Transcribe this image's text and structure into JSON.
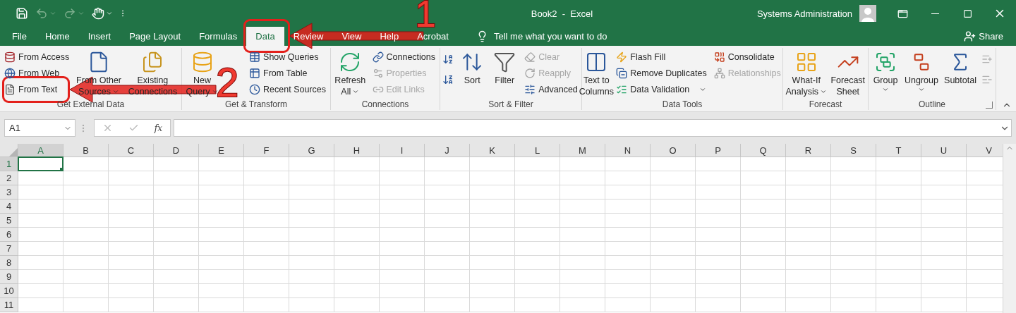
{
  "title_bar": {
    "quick_access": [
      {
        "disabled": false
      },
      {
        "disabled": true
      },
      {
        "disabled": true
      },
      {
        "disabled": false
      }
    ],
    "title": "Book2  -  Excel",
    "user": "Systems Administration"
  },
  "tabs": [
    {
      "label": "File",
      "selected": false
    },
    {
      "label": "Home",
      "selected": false
    },
    {
      "label": "Insert",
      "selected": false
    },
    {
      "label": "Page Layout",
      "selected": false
    },
    {
      "label": "Formulas",
      "selected": false
    },
    {
      "label": "Data",
      "selected": true
    },
    {
      "label": "Review",
      "selected": false
    },
    {
      "label": "View",
      "selected": false
    },
    {
      "label": "Help",
      "selected": false
    },
    {
      "label": "Acrobat",
      "selected": false
    }
  ],
  "tell_me": {
    "placeholder": "Tell me what you want to do"
  },
  "share": "Share",
  "ribbon": {
    "groups": [
      {
        "label": "Get External Data",
        "launcher": false,
        "controls": [
          {
            "kind": "stack",
            "items": [
              {
                "label": "From Access",
                "disabled": false,
                "dropdown": false
              },
              {
                "label": "From Web",
                "disabled": false,
                "dropdown": false
              },
              {
                "label": "From Text",
                "disabled": false,
                "dropdown": false
              }
            ]
          },
          {
            "kind": "large",
            "lines": [
              "From Other",
              "Sources"
            ],
            "dropdown": true
          },
          {
            "kind": "large",
            "lines": [
              "Existing",
              "Connections"
            ],
            "dropdown": false
          }
        ]
      },
      {
        "label": "Get & Transform",
        "launcher": false,
        "controls": [
          {
            "kind": "large",
            "lines": [
              "New",
              "Query"
            ],
            "dropdown": true
          },
          {
            "kind": "stack",
            "items": [
              {
                "label": "Show Queries",
                "disabled": false,
                "dropdown": false
              },
              {
                "label": "From Table",
                "disabled": false,
                "dropdown": false
              },
              {
                "label": "Recent Sources",
                "disabled": false,
                "dropdown": false
              }
            ]
          }
        ]
      },
      {
        "label": "Connections",
        "launcher": false,
        "controls": [
          {
            "kind": "large",
            "lines": [
              "Refresh",
              "All"
            ],
            "dropdown": true
          },
          {
            "kind": "stack",
            "items": [
              {
                "label": "Connections",
                "disabled": false,
                "dropdown": false
              },
              {
                "label": "Properties",
                "disabled": true,
                "dropdown": false
              },
              {
                "label": "Edit Links",
                "disabled": true,
                "dropdown": false
              }
            ]
          }
        ]
      },
      {
        "label": "Sort & Filter",
        "launcher": false,
        "controls": [
          {
            "kind": "icons",
            "items": [
              {
                "disabled": false
              },
              {
                "disabled": false
              }
            ]
          },
          {
            "kind": "large",
            "lines": [
              "Sort"
            ],
            "dropdown": false
          },
          {
            "kind": "large",
            "lines": [
              "Filter"
            ],
            "dropdown": false
          },
          {
            "kind": "stack",
            "items": [
              {
                "label": "Clear",
                "disabled": true,
                "dropdown": false
              },
              {
                "label": "Reapply",
                "disabled": true,
                "dropdown": false
              },
              {
                "label": "Advanced",
                "disabled": false,
                "dropdown": false
              }
            ]
          }
        ]
      },
      {
        "label": "Data Tools",
        "launcher": false,
        "controls": [
          {
            "kind": "large",
            "lines": [
              "Text to",
              "Columns"
            ],
            "dropdown": false
          },
          {
            "kind": "stack",
            "items": [
              {
                "label": "Flash Fill",
                "disabled": false,
                "dropdown": false
              },
              {
                "label": "Remove Duplicates",
                "disabled": false,
                "dropdown": false
              },
              {
                "label": "Data Validation",
                "disabled": false,
                "dropdown": true
              }
            ]
          },
          {
            "kind": "stack",
            "items": [
              {
                "label": "Consolidate",
                "disabled": false,
                "dropdown": false
              },
              {
                "label": "Relationships",
                "disabled": true,
                "dropdown": false
              }
            ]
          }
        ]
      },
      {
        "label": "Forecast",
        "launcher": false,
        "controls": [
          {
            "kind": "large",
            "lines": [
              "What-If",
              "Analysis"
            ],
            "dropdown": true
          },
          {
            "kind": "large",
            "lines": [
              "Forecast",
              "Sheet"
            ],
            "dropdown": false
          }
        ]
      },
      {
        "label": "Outline",
        "launcher": true,
        "controls": [
          {
            "kind": "large",
            "lines": [
              "Group"
            ],
            "dropdown": true
          },
          {
            "kind": "large",
            "lines": [
              "Ungroup"
            ],
            "dropdown": true
          },
          {
            "kind": "large",
            "lines": [
              "Subtotal"
            ],
            "dropdown": false
          },
          {
            "kind": "icons",
            "items": [
              {
                "disabled": true
              },
              {
                "disabled": true
              }
            ]
          }
        ]
      }
    ]
  },
  "formula_bar": {
    "name_box": "A1",
    "function_label": "fx"
  },
  "grid": {
    "columns": [
      {
        "label": "A",
        "selected": true
      },
      {
        "label": "B",
        "selected": false
      },
      {
        "label": "C",
        "selected": false
      },
      {
        "label": "D",
        "selected": false
      },
      {
        "label": "E",
        "selected": false
      },
      {
        "label": "F",
        "selected": false
      },
      {
        "label": "G",
        "selected": false
      },
      {
        "label": "H",
        "selected": false
      },
      {
        "label": "I",
        "selected": false
      },
      {
        "label": "J",
        "selected": false
      },
      {
        "label": "K",
        "selected": false
      },
      {
        "label": "L",
        "selected": false
      },
      {
        "label": "M",
        "selected": false
      },
      {
        "label": "N",
        "selected": false
      },
      {
        "label": "O",
        "selected": false
      },
      {
        "label": "P",
        "selected": false
      },
      {
        "label": "Q",
        "selected": false
      },
      {
        "label": "R",
        "selected": false
      },
      {
        "label": "S",
        "selected": false
      },
      {
        "label": "T",
        "selected": false
      },
      {
        "label": "U",
        "selected": false
      },
      {
        "label": "V",
        "selected": false
      }
    ],
    "rows": [
      {
        "label": "1",
        "selected": true
      },
      {
        "label": "2",
        "selected": false
      },
      {
        "label": "3",
        "selected": false
      },
      {
        "label": "4",
        "selected": false
      },
      {
        "label": "5",
        "selected": false
      },
      {
        "label": "6",
        "selected": false
      },
      {
        "label": "7",
        "selected": false
      },
      {
        "label": "8",
        "selected": false
      },
      {
        "label": "9",
        "selected": false
      },
      {
        "label": "10",
        "selected": false
      },
      {
        "label": "11",
        "selected": false
      }
    ]
  },
  "annotations": [
    {
      "number": "1"
    },
    {
      "number": "2"
    }
  ]
}
